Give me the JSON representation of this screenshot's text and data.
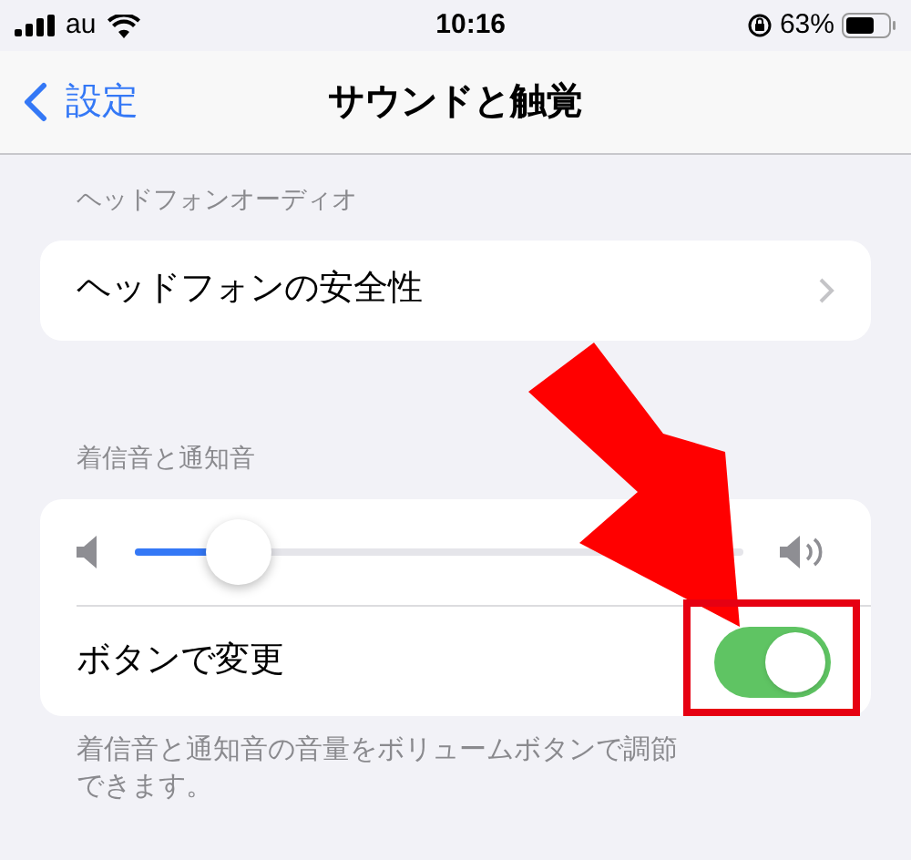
{
  "status_bar": {
    "carrier": "au",
    "time": "10:16",
    "battery": "63%"
  },
  "nav": {
    "back": "設定",
    "title": "サウンドと触覚"
  },
  "sections": [
    {
      "header": "ヘッドフォンオーディオ",
      "rows": [
        {
          "kind": "link",
          "label": "ヘッドフォンの安全性"
        }
      ]
    },
    {
      "header": "着信音と通知音",
      "rows": [
        {
          "kind": "slider",
          "level": 0.17
        },
        {
          "kind": "toggle",
          "label": "ボタンで変更",
          "on": true
        }
      ],
      "footer": "着信音と通知音の音量をボリュームボタンで調節できます。"
    }
  ]
}
